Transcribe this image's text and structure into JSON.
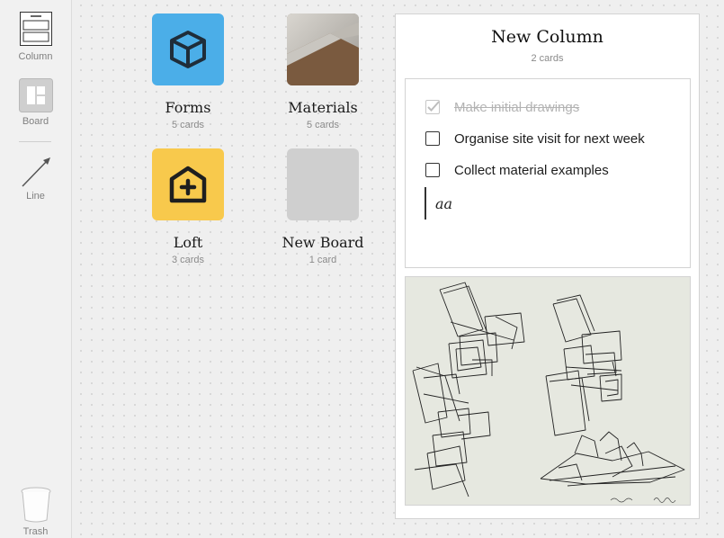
{
  "sidebar": {
    "tools": [
      {
        "label": "Column",
        "icon": "column-icon"
      },
      {
        "label": "Board",
        "icon": "board-icon"
      },
      {
        "label": "Line",
        "icon": "line-icon"
      }
    ],
    "trash": {
      "label": "Trash",
      "icon": "trash-icon"
    }
  },
  "boards": [
    {
      "title": "Forms",
      "count": "5 cards",
      "color": "#4baee8",
      "icon": "cube-icon"
    },
    {
      "title": "Materials",
      "count": "5 cards",
      "icon": "materials-photo"
    },
    {
      "title": "Loft",
      "count": "3 cards",
      "color": "#f8c94c",
      "icon": "house-plus-icon"
    },
    {
      "title": "New Board",
      "count": "1 card",
      "color": "#cfcfcf"
    }
  ],
  "column": {
    "title": "New Column",
    "count": "2 cards",
    "todos": [
      {
        "text": "Make initial drawings",
        "done": true
      },
      {
        "text": "Organise site visit for next week",
        "done": false
      },
      {
        "text": "Collect material examples",
        "done": false
      }
    ],
    "editing_text": "aa",
    "image_card": {
      "icon": "sketch-image"
    }
  }
}
